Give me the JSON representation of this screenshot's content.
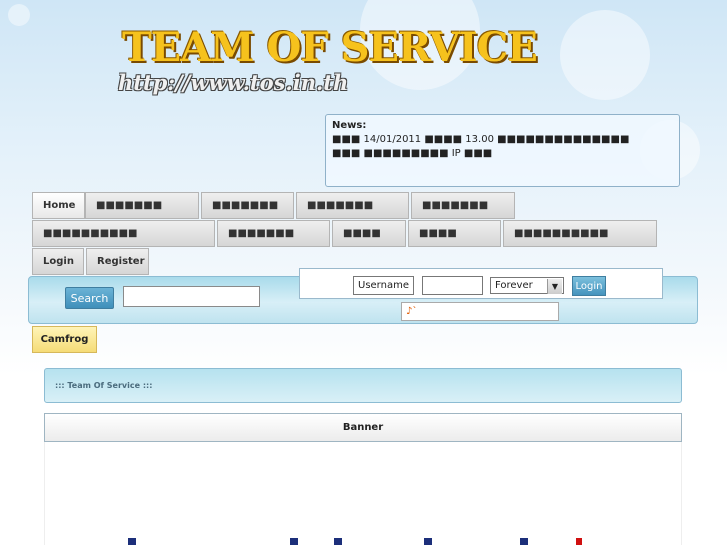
{
  "header": {
    "logo_title": "TEAM OF SERVICE",
    "logo_url": "http://www.tos.in.th"
  },
  "news": {
    "label": "News:",
    "line1": "■■■ 14/01/2011 ■■■■ 13.00 ■■■■■■■■■■■■■■",
    "line2": "■■■ ■■■■■■■■■ IP ■■■"
  },
  "nav": {
    "row1": [
      {
        "label": "Home"
      },
      {
        "label": "■■■■■■■"
      },
      {
        "label": "■■■■■■■"
      },
      {
        "label": "■■■■■■■"
      },
      {
        "label": "■■■■■■■"
      }
    ],
    "row2": [
      {
        "label": "■■■■■■■■■■"
      },
      {
        "label": "■■■■■■■"
      },
      {
        "label": "■■■■"
      },
      {
        "label": "■■■■"
      },
      {
        "label": "■■■■■■■■■■"
      }
    ],
    "row3": [
      {
        "label": "Login"
      },
      {
        "label": "Register"
      }
    ]
  },
  "search": {
    "button_label": "Search",
    "input_value": ""
  },
  "login_form": {
    "username_value": "Username",
    "password_value": "",
    "duration_selected": "Forever",
    "button_label": "Login",
    "extra_value": "♪`"
  },
  "camfrog": {
    "label": "Camfrog"
  },
  "content": {
    "section_title": "::: Team Of Service :::",
    "banner_title": "Banner"
  },
  "colors": {
    "accent": "#3f8fba",
    "logo_gold": "#f6c21d",
    "sky": "#cfe6f6",
    "camfrog_yellow": "#f5dc77"
  }
}
